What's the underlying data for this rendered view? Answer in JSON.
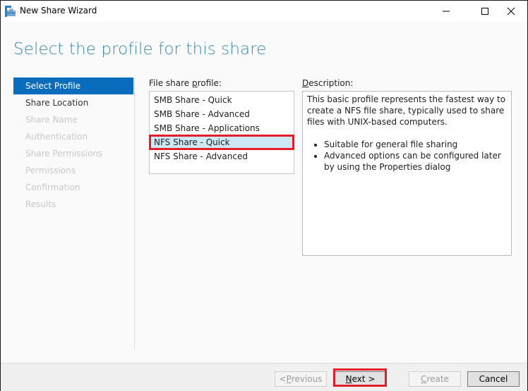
{
  "window": {
    "title": "New Share Wizard",
    "controls": {
      "minimize": "minimize",
      "maximize": "maximize",
      "close": "close"
    }
  },
  "page_title": "Select the profile for this share",
  "nav": {
    "items": [
      {
        "label": "Select Profile",
        "state": "active"
      },
      {
        "label": "Share Location",
        "state": "enabled"
      },
      {
        "label": "Share Name",
        "state": "disabled"
      },
      {
        "label": "Authentication",
        "state": "disabled"
      },
      {
        "label": "Share Permissions",
        "state": "disabled"
      },
      {
        "label": "Permissions",
        "state": "disabled"
      },
      {
        "label": "Confirmation",
        "state": "disabled"
      },
      {
        "label": "Results",
        "state": "disabled"
      }
    ]
  },
  "profile": {
    "label_prefix": "File share ",
    "label_accel": "p",
    "label_suffix": "rofile:",
    "items": [
      "SMB Share - Quick",
      "SMB Share - Advanced",
      "SMB Share - Applications",
      "NFS Share - Quick",
      "NFS Share - Advanced"
    ],
    "selected": "NFS Share - Quick"
  },
  "description": {
    "label_accel": "D",
    "label_suffix": "escription:",
    "text": "This basic profile represents the fastest way to create a NFS file share, typically used to share files with UNIX-based computers.",
    "bullets": [
      "Suitable for general file sharing",
      "Advanced options can be configured later by using the Properties dialog"
    ]
  },
  "footer": {
    "previous": {
      "prefix": "< ",
      "accel": "P",
      "suffix": "revious",
      "enabled": false
    },
    "next": {
      "accel": "N",
      "suffix": "ext >",
      "enabled": true
    },
    "create": {
      "accel": "C",
      "suffix": "reate",
      "enabled": false
    },
    "cancel": {
      "label": "Cancel",
      "enabled": true
    }
  },
  "colors": {
    "accent": "#0a6cbd",
    "title": "#3a8bb5",
    "highlight": "#e21e2a",
    "selection": "#cce8f4"
  }
}
